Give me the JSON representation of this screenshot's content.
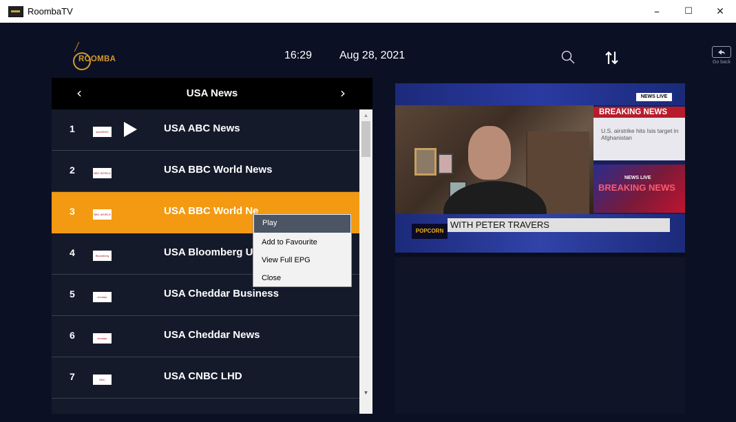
{
  "window": {
    "title": "RoombaTV",
    "minimize": "–",
    "maximize": "☐",
    "close": "✕"
  },
  "header": {
    "logo_text": "ROOMBA",
    "time": "16:29",
    "date": "Aug 28, 2021",
    "search_icon": "search-icon",
    "sort_icon": "sort-icon",
    "go_back": "Go back"
  },
  "panel": {
    "title": "USA News",
    "prev": "‹",
    "next": "›",
    "channels": [
      {
        "num": "1",
        "name": "USA ABC News"
      },
      {
        "num": "2",
        "name": "USA BBC World News"
      },
      {
        "num": "3",
        "name": "USA BBC World Ne"
      },
      {
        "num": "4",
        "name": "USA Bloomberg Ul"
      },
      {
        "num": "5",
        "name": "USA Cheddar Business"
      },
      {
        "num": "6",
        "name": "USA Cheddar News"
      },
      {
        "num": "7",
        "name": "USA CNBC LHD"
      }
    ],
    "channel_logos": [
      "abcNEWS",
      "BBC WORLD NEWS",
      "BBC WORLD NEWS",
      "Bloomberg",
      "cheddar",
      "cheddar",
      "NBC"
    ],
    "scroll_up": "▲",
    "scroll_down": "▼",
    "selected_index": 2,
    "selected_color": "#f39a12"
  },
  "context_menu": {
    "items": [
      "Play",
      "Add to Favourite",
      "View Full EPG",
      "Close"
    ]
  },
  "video": {
    "brand": "NEWS LIVE",
    "breaking": "BREAKING NEWS",
    "story": "U.S. airstrike hits Isis target in Afghanistan",
    "promo_top": "NEWS LIVE",
    "promo_main": "BREAKING NEWS",
    "popcorn": "POPCORN",
    "lower_third": "WITH PETER TRAVERS"
  }
}
